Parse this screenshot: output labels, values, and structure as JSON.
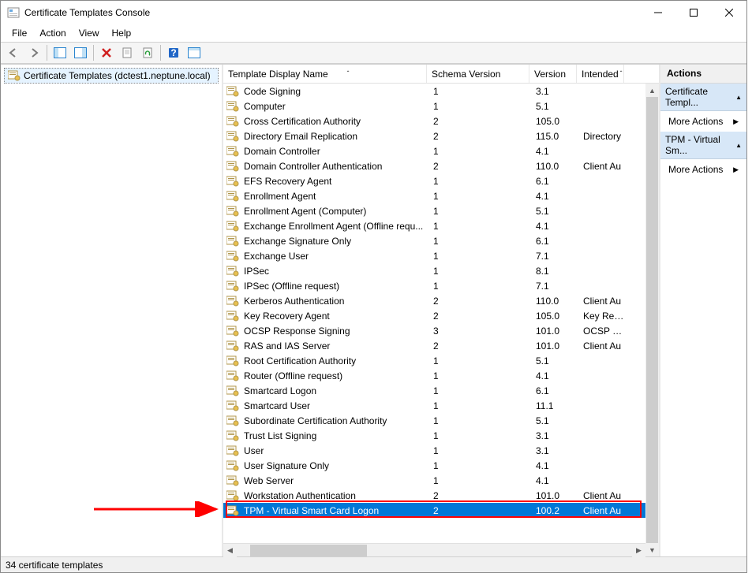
{
  "window": {
    "title": "Certificate Templates Console"
  },
  "menubar": [
    "File",
    "Action",
    "View",
    "Help"
  ],
  "tree": {
    "root_label": "Certificate Templates (dctest1.neptune.local)"
  },
  "list_headers": {
    "name": "Template Display Name",
    "schema": "Schema Version",
    "version": "Version",
    "intended": "Intended"
  },
  "templates": [
    {
      "name": "Code Signing",
      "schema": "1",
      "ver": "3.1",
      "intended": ""
    },
    {
      "name": "Computer",
      "schema": "1",
      "ver": "5.1",
      "intended": ""
    },
    {
      "name": "Cross Certification Authority",
      "schema": "2",
      "ver": "105.0",
      "intended": ""
    },
    {
      "name": "Directory Email Replication",
      "schema": "2",
      "ver": "115.0",
      "intended": "Directory"
    },
    {
      "name": "Domain Controller",
      "schema": "1",
      "ver": "4.1",
      "intended": ""
    },
    {
      "name": "Domain Controller Authentication",
      "schema": "2",
      "ver": "110.0",
      "intended": "Client Au"
    },
    {
      "name": "EFS Recovery Agent",
      "schema": "1",
      "ver": "6.1",
      "intended": ""
    },
    {
      "name": "Enrollment Agent",
      "schema": "1",
      "ver": "4.1",
      "intended": ""
    },
    {
      "name": "Enrollment Agent (Computer)",
      "schema": "1",
      "ver": "5.1",
      "intended": ""
    },
    {
      "name": "Exchange Enrollment Agent (Offline requ...",
      "schema": "1",
      "ver": "4.1",
      "intended": ""
    },
    {
      "name": "Exchange Signature Only",
      "schema": "1",
      "ver": "6.1",
      "intended": ""
    },
    {
      "name": "Exchange User",
      "schema": "1",
      "ver": "7.1",
      "intended": ""
    },
    {
      "name": "IPSec",
      "schema": "1",
      "ver": "8.1",
      "intended": ""
    },
    {
      "name": "IPSec (Offline request)",
      "schema": "1",
      "ver": "7.1",
      "intended": ""
    },
    {
      "name": "Kerberos Authentication",
      "schema": "2",
      "ver": "110.0",
      "intended": "Client Au"
    },
    {
      "name": "Key Recovery Agent",
      "schema": "2",
      "ver": "105.0",
      "intended": "Key Reco"
    },
    {
      "name": "OCSP Response Signing",
      "schema": "3",
      "ver": "101.0",
      "intended": "OCSP Sig"
    },
    {
      "name": "RAS and IAS Server",
      "schema": "2",
      "ver": "101.0",
      "intended": "Client Au"
    },
    {
      "name": "Root Certification Authority",
      "schema": "1",
      "ver": "5.1",
      "intended": ""
    },
    {
      "name": "Router (Offline request)",
      "schema": "1",
      "ver": "4.1",
      "intended": ""
    },
    {
      "name": "Smartcard Logon",
      "schema": "1",
      "ver": "6.1",
      "intended": ""
    },
    {
      "name": "Smartcard User",
      "schema": "1",
      "ver": "11.1",
      "intended": ""
    },
    {
      "name": "Subordinate Certification Authority",
      "schema": "1",
      "ver": "5.1",
      "intended": ""
    },
    {
      "name": "Trust List Signing",
      "schema": "1",
      "ver": "3.1",
      "intended": ""
    },
    {
      "name": "User",
      "schema": "1",
      "ver": "3.1",
      "intended": ""
    },
    {
      "name": "User Signature Only",
      "schema": "1",
      "ver": "4.1",
      "intended": ""
    },
    {
      "name": "Web Server",
      "schema": "1",
      "ver": "4.1",
      "intended": ""
    },
    {
      "name": "Workstation Authentication",
      "schema": "2",
      "ver": "101.0",
      "intended": "Client Au"
    },
    {
      "name": "TPM - Virtual Smart Card Logon",
      "schema": "2",
      "ver": "100.2",
      "intended": "Client Au",
      "selected": true
    }
  ],
  "actions": {
    "title": "Actions",
    "sections": [
      {
        "head": "Certificate Templ...",
        "items": [
          "More Actions"
        ]
      },
      {
        "head": "TPM - Virtual Sm...",
        "items": [
          "More Actions"
        ]
      }
    ]
  },
  "status": "34 certificate templates"
}
